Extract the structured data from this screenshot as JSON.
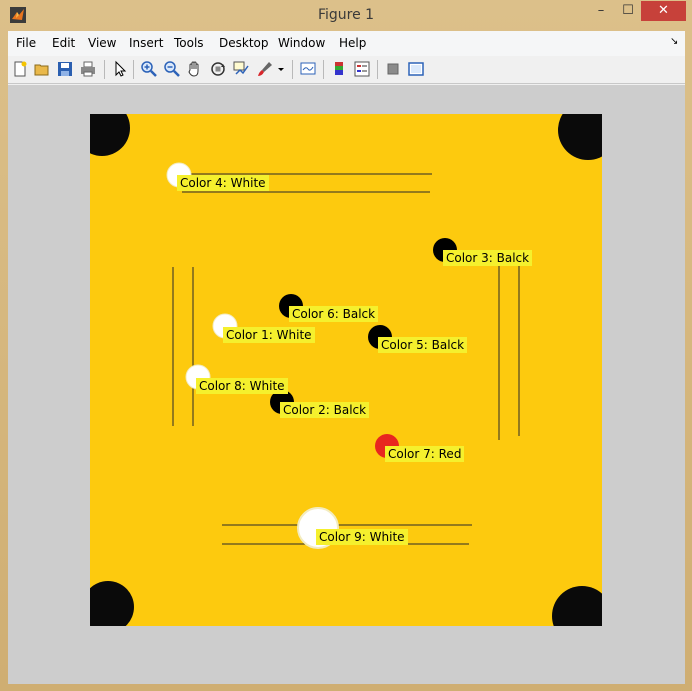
{
  "window": {
    "title": "Figure 1",
    "min": "–",
    "max": "☐",
    "close": "✕"
  },
  "menu": [
    "File",
    "Edit",
    "View",
    "Insert",
    "Tools",
    "Desktop",
    "Window",
    "Help"
  ],
  "menu_overflow": "↘",
  "toolbar_icons": [
    "new-figure-icon",
    "open-file-icon",
    "save-icon",
    "print-icon",
    "pointer-icon",
    "zoom-in-icon",
    "zoom-out-icon",
    "pan-icon",
    "rotate-3d-icon",
    "data-cursor-icon",
    "brush-icon",
    "brush-dropdown-icon",
    "link-plot-icon",
    "colorbar-icon",
    "legend-icon",
    "hide-plot-tools-icon",
    "show-plot-tools-icon"
  ],
  "labels": [
    "Color 4: White",
    "Color 3: Balck",
    "Color 6: Balck",
    "Color 1: White",
    "Color 5: Balck",
    "Color 8: White",
    "Color 2: Balck",
    "Color 7: Red",
    "Color 9: White"
  ],
  "colors": {
    "board": "#fdca0e",
    "label_bg": "#f5f02d",
    "white_coin": "#ffffff",
    "black_coin": "#000000",
    "red_coin": "#e8261f"
  }
}
